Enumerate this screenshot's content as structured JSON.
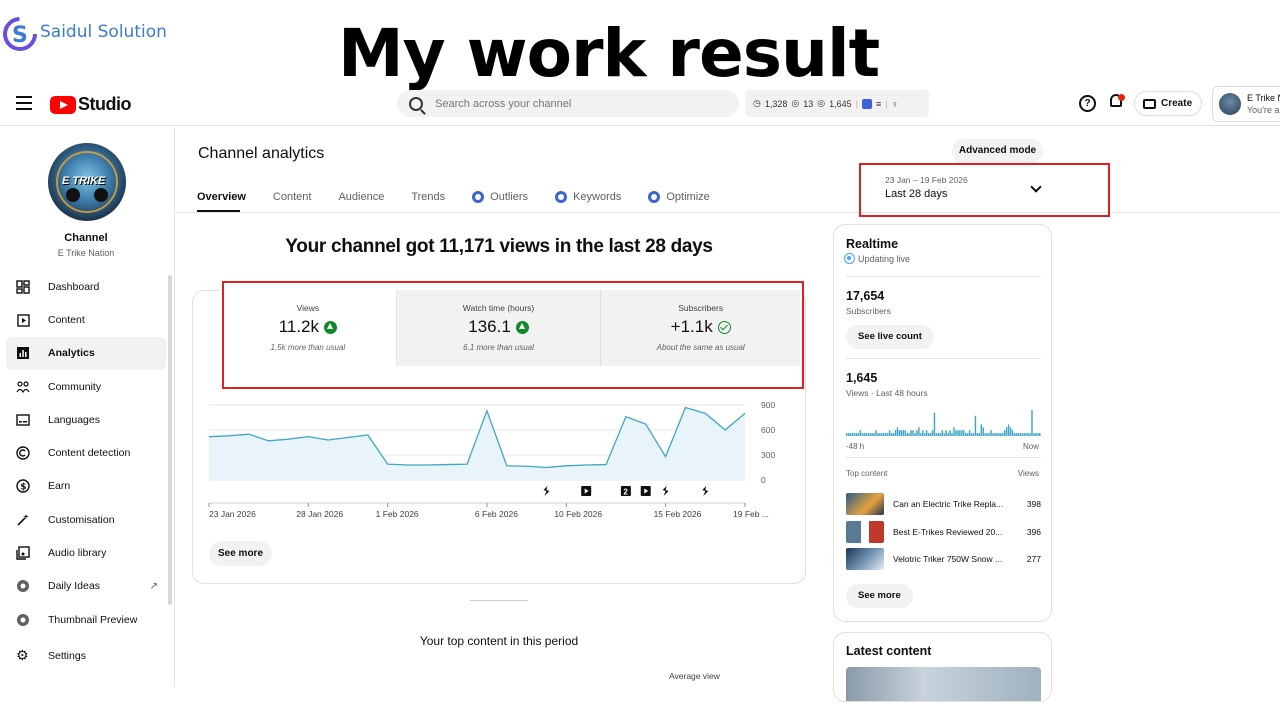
{
  "overlay": {
    "brand_name": "Saidul Solution",
    "headline": "My work result"
  },
  "header": {
    "studio_label": "Studio",
    "search_placeholder": "Search across your channel",
    "stats": [
      "1,328",
      "13",
      "1,645"
    ],
    "create_label": "Create",
    "account_name": "E Trike N",
    "account_sub": "You're an"
  },
  "sidebar": {
    "channel_title": "Channel",
    "channel_name": "E Trike Nation",
    "avatar_text": "E TRIKE",
    "items": [
      {
        "label": "Dashboard",
        "icon": "dashboard-icon"
      },
      {
        "label": "Content",
        "icon": "content-icon"
      },
      {
        "label": "Analytics",
        "icon": "analytics-icon"
      },
      {
        "label": "Community",
        "icon": "community-icon"
      },
      {
        "label": "Languages",
        "icon": "languages-icon"
      },
      {
        "label": "Content detection",
        "icon": "copyright-icon"
      },
      {
        "label": "Earn",
        "icon": "dollar-icon"
      },
      {
        "label": "Customisation",
        "icon": "wand-icon"
      },
      {
        "label": "Audio library",
        "icon": "audio-library-icon"
      },
      {
        "label": "Daily Ideas",
        "icon": "extension-icon"
      },
      {
        "label": "Thumbnail Preview",
        "icon": "extension-icon"
      }
    ],
    "settings_label": "Settings"
  },
  "main": {
    "page_title": "Channel analytics",
    "advanced_mode": "Advanced mode",
    "tabs": [
      "Overview",
      "Content",
      "Audience",
      "Trends",
      "Outliers",
      "Keywords",
      "Optimize"
    ],
    "date_range": "23 Jan – 19 Feb 2026",
    "date_period": "Last 28 days",
    "headline": "Your channel got 11,171 views in the last 28 days",
    "metrics": [
      {
        "label": "Views",
        "value": "11.2k",
        "note": "1.5k more than usual",
        "trend": "up"
      },
      {
        "label": "Watch time (hours)",
        "value": "136.1",
        "note": "6.1 more than usual",
        "trend": "up"
      },
      {
        "label": "Subscribers",
        "value": "+1.1k",
        "note": "About the same as usual",
        "trend": "same"
      }
    ],
    "see_more": "See more",
    "top_content_title": "Your top content in this period",
    "avg_view": "Average view"
  },
  "chart_data": {
    "type": "area",
    "x": [
      "23 Jan 2026",
      "24 Jan",
      "25 Jan",
      "26 Jan",
      "27 Jan",
      "28 Jan 2026",
      "29 Jan",
      "30 Jan",
      "31 Jan",
      "1 Feb 2026",
      "2 Feb",
      "3 Feb",
      "4 Feb",
      "5 Feb",
      "6 Feb 2026",
      "7 Feb",
      "8 Feb",
      "9 Feb",
      "10 Feb 2026",
      "11 Feb",
      "12 Feb",
      "13 Feb",
      "14 Feb",
      "15 Feb 2026",
      "16 Feb",
      "17 Feb",
      "18 Feb",
      "19 Feb"
    ],
    "values": [
      520,
      530,
      550,
      470,
      490,
      520,
      480,
      510,
      540,
      190,
      180,
      180,
      185,
      190,
      830,
      170,
      165,
      150,
      170,
      180,
      185,
      760,
      670,
      280,
      870,
      800,
      600,
      800
    ],
    "series": [
      {
        "name": "Views",
        "values": []
      }
    ],
    "tick_labels": [
      "23 Jan 2026",
      "28 Jan 2026",
      "1 Feb 2026",
      "6 Feb 2026",
      "10 Feb 2026",
      "15 Feb 2026",
      "19 Feb ..."
    ],
    "tick_indices": [
      0,
      5,
      9,
      14,
      18,
      23,
      27
    ],
    "y_ticks": [
      0,
      300,
      600,
      900
    ],
    "ylim": [
      0,
      900
    ],
    "title": "",
    "xlabel": "",
    "ylabel": "",
    "grid": true,
    "fill_color": "#e8f3fa",
    "line_color": "#3ea6c8",
    "markers": [
      {
        "index": 17,
        "icon": "shorts-icon"
      },
      {
        "index": 19,
        "icon": "video-icon"
      },
      {
        "index": 21,
        "icon": "count-badge",
        "label": "2"
      },
      {
        "index": 22,
        "icon": "video-icon"
      },
      {
        "index": 23,
        "icon": "shorts-icon"
      },
      {
        "index": 25,
        "icon": "shorts-icon"
      }
    ]
  },
  "realtime": {
    "title": "Realtime",
    "status": "Updating live",
    "subs_value": "17,654",
    "subs_label": "Subscribers",
    "live_count_btn": "See live count",
    "views_value": "1,645",
    "views_label": "Views · Last 48 hours",
    "axis_left": "-48 h",
    "axis_right": "Now",
    "top_content_label": "Top content",
    "views_col": "Views",
    "rows": [
      {
        "title": "Can an Electric Trike Repla...",
        "views": "398"
      },
      {
        "title": "Best E-Trikes Reviewed 20...",
        "views": "396"
      },
      {
        "title": "Velotric Triker 750W Snow ...",
        "views": "277"
      }
    ],
    "see_more": "See more",
    "spark": [
      1,
      1,
      1,
      1,
      1,
      1,
      1,
      2,
      1,
      1,
      1,
      1,
      1,
      1,
      1,
      2,
      1,
      1,
      1,
      1,
      1,
      1,
      2,
      1,
      1,
      2,
      3,
      2,
      2,
      2,
      2,
      1,
      1,
      2,
      2,
      1,
      2,
      3,
      1,
      2,
      1,
      2,
      1,
      1,
      2,
      8,
      1,
      1,
      1,
      2,
      1,
      2,
      1,
      2,
      1,
      3,
      2,
      2,
      2,
      2,
      2,
      1,
      1,
      2,
      1,
      1,
      7,
      1,
      1,
      4,
      3,
      1,
      1,
      1,
      2,
      1,
      1,
      1,
      1,
      1,
      1,
      2,
      3,
      4,
      3,
      2,
      1,
      1,
      1,
      1,
      1,
      1,
      1,
      1,
      1,
      9,
      1,
      1,
      1,
      1
    ]
  },
  "latest": {
    "title": "Latest content"
  }
}
